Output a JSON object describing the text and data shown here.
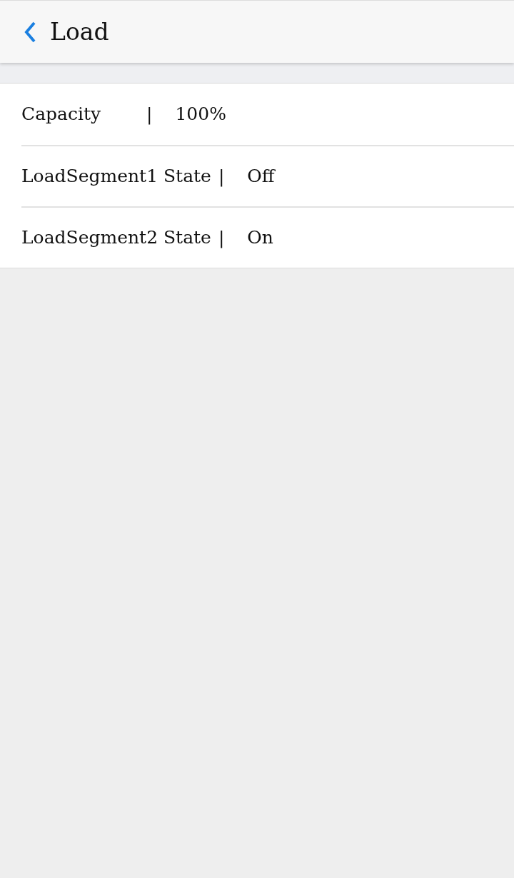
{
  "header": {
    "title": "Load"
  },
  "rows": [
    {
      "label": "Capacity",
      "separator": "|",
      "value": "100%"
    },
    {
      "label": "LoadSegment1 State",
      "separator": "|",
      "value": "Off"
    },
    {
      "label": "LoadSegment2 State",
      "separator": "|",
      "value": "On"
    }
  ]
}
